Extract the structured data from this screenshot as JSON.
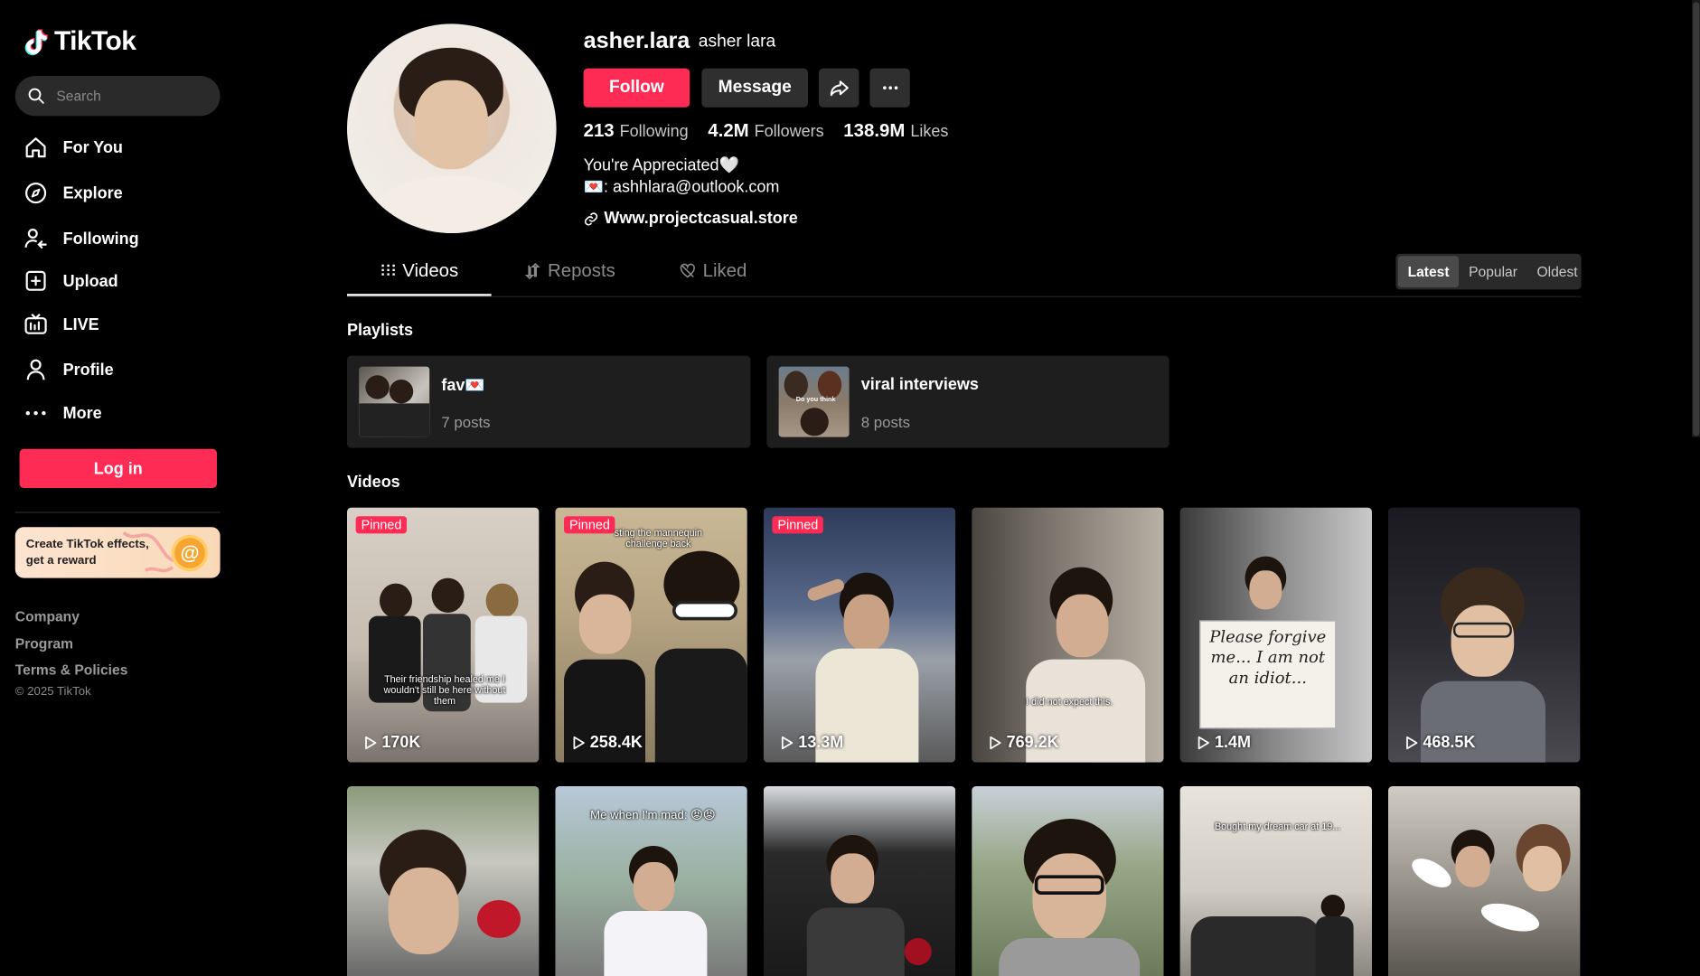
{
  "app": {
    "name": "TikTok"
  },
  "search": {
    "placeholder": "Search"
  },
  "nav": [
    {
      "label": "For You",
      "icon": "home-icon"
    },
    {
      "label": "Explore",
      "icon": "compass-icon"
    },
    {
      "label": "Following",
      "icon": "following-icon"
    },
    {
      "label": "Upload",
      "icon": "upload-icon"
    },
    {
      "label": "LIVE",
      "icon": "live-icon"
    },
    {
      "label": "Profile",
      "icon": "profile-icon"
    },
    {
      "label": "More",
      "icon": "more-icon"
    }
  ],
  "login_label": "Log in",
  "promo": {
    "text": "Create TikTok effects, get a reward"
  },
  "footer": {
    "links": [
      "Company",
      "Program",
      "Terms & Policies"
    ],
    "copyright": "© 2025 TikTok"
  },
  "profile": {
    "username": "asher.lara",
    "nickname": "asher lara",
    "follow_label": "Follow",
    "message_label": "Message",
    "stats": [
      {
        "value": "213",
        "label": "Following"
      },
      {
        "value": "4.2M",
        "label": "Followers"
      },
      {
        "value": "138.9M",
        "label": "Likes"
      }
    ],
    "bio_line1": "You're Appreciated🤍",
    "bio_line2": "💌: ashhlara@outlook.com",
    "link": "Www.projectcasual.store"
  },
  "tabs": [
    {
      "label": "Videos",
      "icon": "grid-icon"
    },
    {
      "label": "Reposts",
      "icon": "repost-icon"
    },
    {
      "label": "Liked",
      "icon": "liked-icon"
    }
  ],
  "sort": [
    "Latest",
    "Popular",
    "Oldest"
  ],
  "playlists_title": "Playlists",
  "playlists": [
    {
      "name": "fav💌",
      "count": "7 posts"
    },
    {
      "name": "viral interviews",
      "count": "8 posts"
    }
  ],
  "videos_title": "Videos",
  "pinned_label": "Pinned",
  "videos": [
    {
      "views": "170K",
      "pinned": true,
      "caption": "Their friendship healed me I wouldn't still be here without them"
    },
    {
      "views": "258.4K",
      "pinned": true,
      "caption": "sting the mannequin challenge back"
    },
    {
      "views": "13.3M",
      "pinned": true,
      "caption": ""
    },
    {
      "views": "769.2K",
      "pinned": false,
      "caption": "I did not expect this."
    },
    {
      "views": "1.4M",
      "pinned": false,
      "caption": "Please forgive me... I am not an idiot..."
    },
    {
      "views": "468.5K",
      "pinned": false,
      "caption": ""
    },
    {
      "views": "",
      "pinned": false,
      "caption": ""
    },
    {
      "views": "",
      "pinned": false,
      "caption": "Me when I'm mad: 😡😡"
    },
    {
      "views": "",
      "pinned": false,
      "caption": ""
    },
    {
      "views": "",
      "pinned": false,
      "caption": ""
    },
    {
      "views": "",
      "pinned": false,
      "caption": "Bought my dream car at 19..."
    },
    {
      "views": "",
      "pinned": false,
      "caption": ""
    }
  ],
  "colors": {
    "accent": "#fe2c55",
    "bg": "#000000",
    "panel": "#1e1e1e",
    "button": "#2f2f2f"
  }
}
